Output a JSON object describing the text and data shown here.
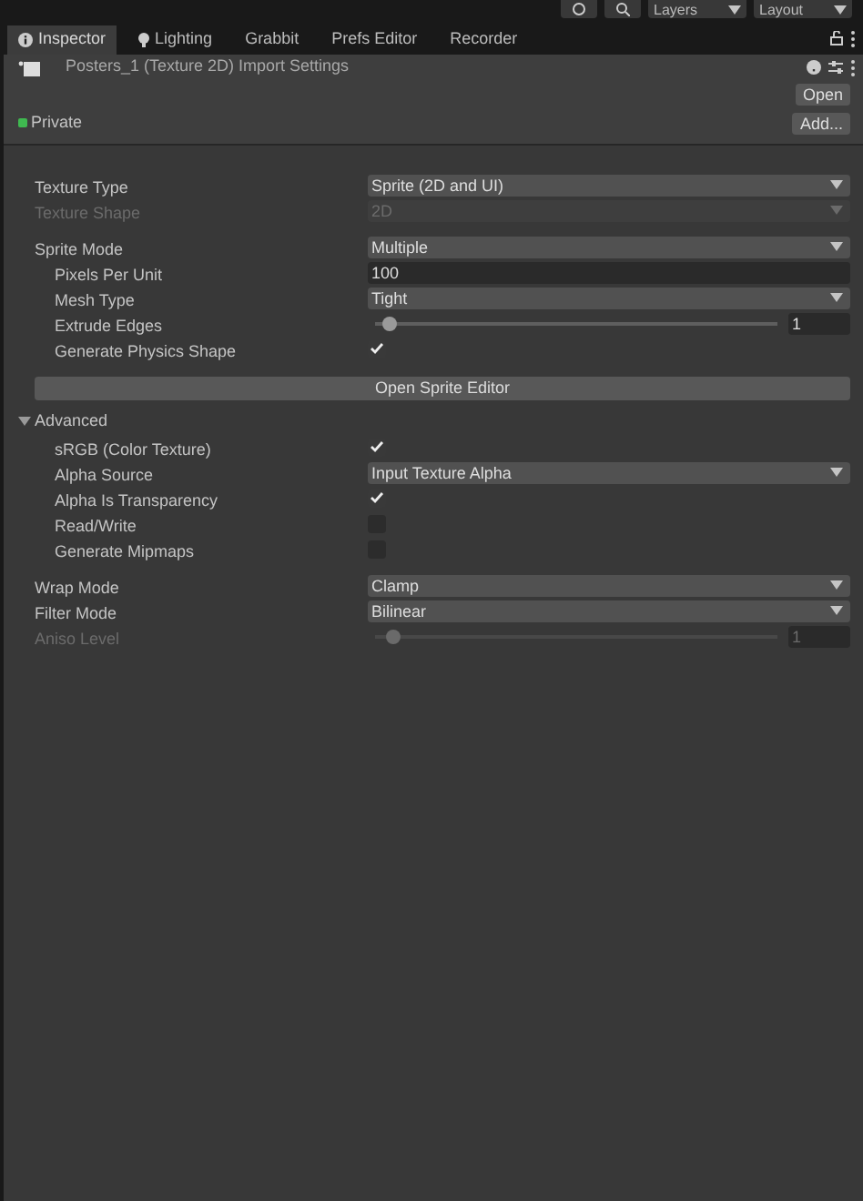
{
  "toolbar": {
    "dropdowns": [
      {
        "label": "Layers"
      },
      {
        "label": "Layout"
      }
    ]
  },
  "tabs": [
    {
      "label": "Inspector",
      "selected": true
    },
    {
      "label": "Lighting",
      "selected": false
    },
    {
      "label": "Grabbit",
      "selected": false
    },
    {
      "label": "Prefs Editor",
      "selected": false
    },
    {
      "label": "Recorder",
      "selected": false
    }
  ],
  "header": {
    "title": "Posters_1 (Texture 2D) Import Settings",
    "open_button": "Open",
    "add_button": "Add...",
    "asset_label": {
      "label": "Private",
      "color": "#3fb950"
    }
  },
  "groups": [
    [
      {
        "kind": "dropdown",
        "label": "Texture Type",
        "value": "Sprite (2D and UI)",
        "disabled": false
      },
      {
        "kind": "dropdown",
        "label": "Texture Shape",
        "value": "2D",
        "disabled": true
      }
    ],
    [
      {
        "kind": "dropdown",
        "label": "Sprite Mode",
        "value": "Multiple",
        "disabled": false,
        "children": [
          {
            "kind": "text",
            "label": "Pixels Per Unit",
            "value": "100"
          },
          {
            "kind": "dropdown",
            "label": "Mesh Type",
            "value": "Tight",
            "disabled": false
          },
          {
            "kind": "slider",
            "label": "Extrude Edges",
            "value": "1",
            "level": 0.01,
            "disabled": false
          },
          {
            "kind": "checkbox",
            "label": "Generate Physics Shape",
            "checked": true
          }
        ]
      },
      {
        "kind": "button",
        "label": "Open Sprite Editor"
      },
      {
        "kind": "foldout",
        "label": "Advanced",
        "expanded": true,
        "children": [
          {
            "kind": "checkbox",
            "label": "sRGB (Color Texture)",
            "checked": true
          },
          {
            "kind": "dropdown",
            "label": "Alpha Source",
            "value": "Input Texture Alpha",
            "disabled": false
          },
          {
            "kind": "checkbox",
            "label": "Alpha Is Transparency",
            "checked": true
          },
          {
            "kind": "checkbox",
            "label": "Read/Write",
            "checked": false
          },
          {
            "kind": "checkbox",
            "label": "Generate Mipmaps",
            "checked": false
          }
        ]
      }
    ],
    [
      {
        "kind": "dropdown",
        "label": "Wrap Mode",
        "value": "Clamp",
        "disabled": false
      },
      {
        "kind": "dropdown",
        "label": "Filter Mode",
        "value": "Bilinear",
        "disabled": false
      },
      {
        "kind": "slider",
        "label": "Aniso Level",
        "value": "1",
        "level": 0.02,
        "disabled": true
      }
    ]
  ]
}
